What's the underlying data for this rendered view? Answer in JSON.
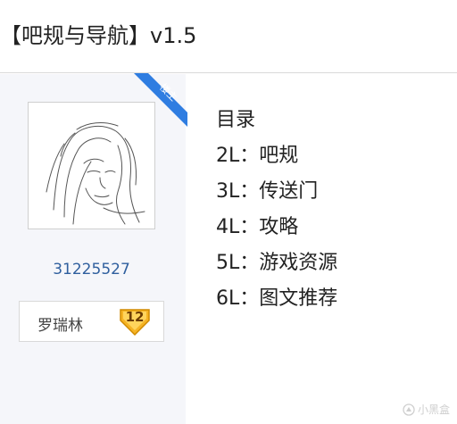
{
  "header": {
    "title": "【吧规与导航】v1.5"
  },
  "post": {
    "badge_text": "楼主",
    "username": "31225527",
    "level_name": "罗瑞林",
    "level_number": "12"
  },
  "content": {
    "toc_heading": "目录",
    "items": [
      {
        "label": "2L：吧规"
      },
      {
        "label": "3L：传送门"
      },
      {
        "label": "4L：攻略"
      },
      {
        "label": "5L：游戏资源"
      },
      {
        "label": "6L：图文推荐"
      }
    ]
  },
  "watermark": {
    "text": "小黑盒"
  },
  "colors": {
    "ribbon": "#2f7de1",
    "username": "#2f5f9e",
    "badge": "#f5b324"
  }
}
